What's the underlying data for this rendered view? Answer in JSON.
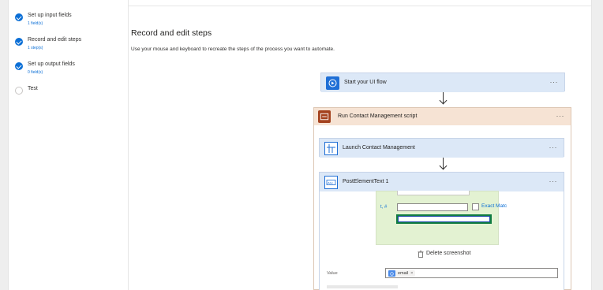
{
  "steps": [
    {
      "title": "Set up input fields",
      "sub": "1 field(s)",
      "state": "done"
    },
    {
      "title": "Record and edit steps",
      "sub": "1 step(s)",
      "state": "done"
    },
    {
      "title": "Set up output fields",
      "sub": "0 field(s)",
      "state": "done"
    },
    {
      "title": "Test",
      "sub": "",
      "state": "todo"
    }
  ],
  "main": {
    "title": "Record and edit steps",
    "description": "Use your mouse and keyboard to recreate the steps of the process you want to automate."
  },
  "flow": {
    "start_label": "Start your UI flow",
    "script_label": "Run Contact Management script",
    "launch_label": "Launch Contact Management",
    "post_label": "PostElementText 1",
    "more": "···"
  },
  "screenshot": {
    "row_label": "t, #",
    "check_label": "Exact Matc"
  },
  "delete_label": "Delete screenshot",
  "value": {
    "label": "Value",
    "token": "email",
    "token_remove": "×"
  },
  "colors": {
    "accent": "#0b6fd6",
    "flow_header": "#dce8f7",
    "script_header": "#f6e3d4",
    "screenshot_bg": "#e3f2d2"
  }
}
